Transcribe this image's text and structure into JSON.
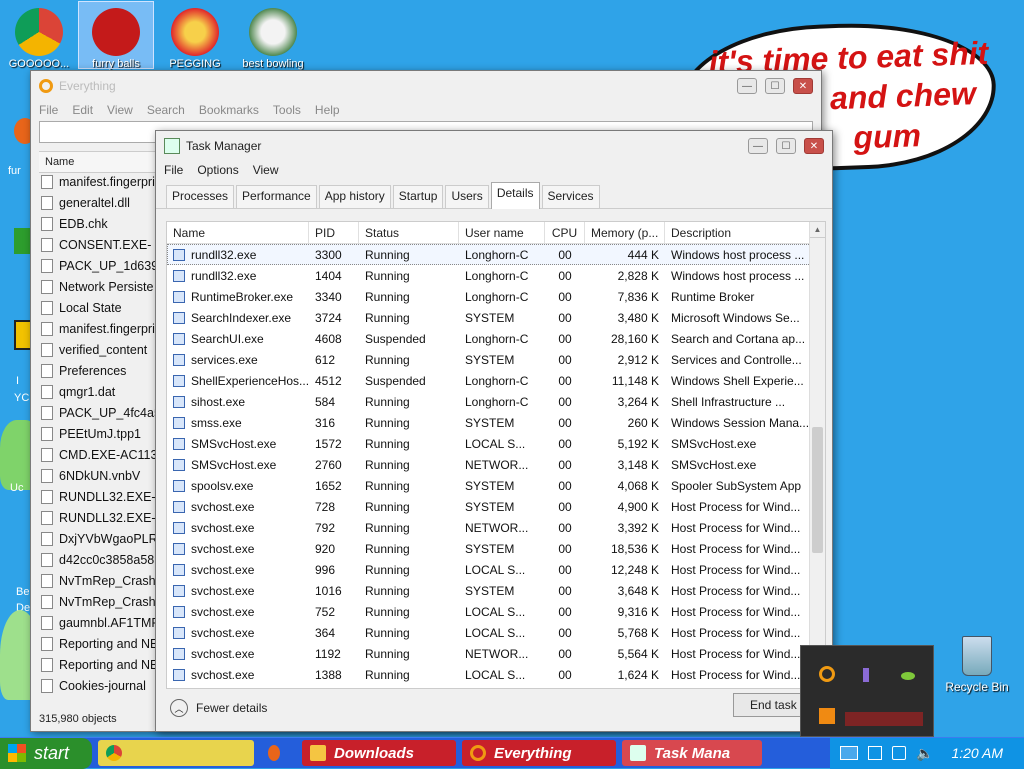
{
  "desktop": {
    "icons": [
      {
        "label": "GOOOOO...",
        "color": "#dd4b39"
      },
      {
        "label": "furry balls",
        "color": "#c41a1a"
      },
      {
        "label": "PEGGING",
        "color": "#e0282b"
      },
      {
        "label": "best bowling",
        "color": "#3a7a3a"
      }
    ],
    "left_labels": [
      "fur",
      "I",
      "YC",
      "Uc",
      "Be",
      "De"
    ],
    "recycle_bin": "Recycle Bin"
  },
  "bubble": {
    "lines": [
      "it's time to eat shit",
      "and chew",
      "gum"
    ]
  },
  "everything": {
    "title": "Everything",
    "menu": [
      "File",
      "Edit",
      "View",
      "Search",
      "Bookmarks",
      "Tools",
      "Help"
    ],
    "search_value": "",
    "column": "Name",
    "files": [
      "manifest.fingerpri",
      "generaltel.dll",
      "EDB.chk",
      "CONSENT.EXE-",
      "PACK_UP_1d639f",
      "Network Persiste",
      "Local State",
      "manifest.fingerpri",
      "verified_content",
      "Preferences",
      "qmgr1.dat",
      "PACK_UP_4fc4a5",
      "PEEtUmJ.tpp1",
      "CMD.EXE-AC113A",
      "6NDkUN.vnbV",
      "RUNDLL32.EXE-",
      "RUNDLL32.EXE-",
      "DxjYVbWgaoPLR",
      "d42cc0c3858a58",
      "NvTmRep_CrashR",
      "NvTmRep_CrashR",
      "gaumnbl.AF1TMP",
      "Reporting and NE",
      "Reporting and NE",
      "Cookies-journal"
    ],
    "status": "315,980 objects"
  },
  "taskmanager": {
    "title": "Task Manager",
    "menu": [
      "File",
      "Options",
      "View"
    ],
    "tabs": [
      "Processes",
      "Performance",
      "App history",
      "Startup",
      "Users",
      "Details",
      "Services"
    ],
    "active_tab": "Details",
    "columns": [
      "Name",
      "PID",
      "Status",
      "User name",
      "CPU",
      "Memory (p...",
      "Description"
    ],
    "rows": [
      [
        "rundll32.exe",
        "3300",
        "Running",
        "Longhorn-C",
        "00",
        "444 K",
        "Windows host process ..."
      ],
      [
        "rundll32.exe",
        "1404",
        "Running",
        "Longhorn-C",
        "00",
        "2,828 K",
        "Windows host process ..."
      ],
      [
        "RuntimeBroker.exe",
        "3340",
        "Running",
        "Longhorn-C",
        "00",
        "7,836 K",
        "Runtime Broker"
      ],
      [
        "SearchIndexer.exe",
        "3724",
        "Running",
        "SYSTEM",
        "00",
        "3,480 K",
        "Microsoft Windows Se..."
      ],
      [
        "SearchUI.exe",
        "4608",
        "Suspended",
        "Longhorn-C",
        "00",
        "28,160 K",
        "Search and Cortana ap..."
      ],
      [
        "services.exe",
        "612",
        "Running",
        "SYSTEM",
        "00",
        "2,912 K",
        "Services and Controlle..."
      ],
      [
        "ShellExperienceHos...",
        "4512",
        "Suspended",
        "Longhorn-C",
        "00",
        "11,148 K",
        "Windows Shell Experie..."
      ],
      [
        "sihost.exe",
        "584",
        "Running",
        "Longhorn-C",
        "00",
        "3,264 K",
        "Shell Infrastructure ..."
      ],
      [
        "smss.exe",
        "316",
        "Running",
        "SYSTEM",
        "00",
        "260 K",
        "Windows Session Mana..."
      ],
      [
        "SMSvcHost.exe",
        "1572",
        "Running",
        "LOCAL S...",
        "00",
        "5,192 K",
        "SMSvcHost.exe"
      ],
      [
        "SMSvcHost.exe",
        "2760",
        "Running",
        "NETWOR...",
        "00",
        "3,148 K",
        "SMSvcHost.exe"
      ],
      [
        "spoolsv.exe",
        "1652",
        "Running",
        "SYSTEM",
        "00",
        "4,068 K",
        "Spooler SubSystem App"
      ],
      [
        "svchost.exe",
        "728",
        "Running",
        "SYSTEM",
        "00",
        "4,900 K",
        "Host Process for Wind..."
      ],
      [
        "svchost.exe",
        "792",
        "Running",
        "NETWOR...",
        "00",
        "3,392 K",
        "Host Process for Wind..."
      ],
      [
        "svchost.exe",
        "920",
        "Running",
        "SYSTEM",
        "00",
        "18,536 K",
        "Host Process for Wind..."
      ],
      [
        "svchost.exe",
        "996",
        "Running",
        "LOCAL S...",
        "00",
        "12,248 K",
        "Host Process for Wind..."
      ],
      [
        "svchost.exe",
        "1016",
        "Running",
        "SYSTEM",
        "00",
        "3,648 K",
        "Host Process for Wind..."
      ],
      [
        "svchost.exe",
        "752",
        "Running",
        "LOCAL S...",
        "00",
        "9,316 K",
        "Host Process for Wind..."
      ],
      [
        "svchost.exe",
        "364",
        "Running",
        "LOCAL S...",
        "00",
        "5,768 K",
        "Host Process for Wind..."
      ],
      [
        "svchost.exe",
        "1192",
        "Running",
        "NETWOR...",
        "00",
        "5,564 K",
        "Host Process for Wind..."
      ],
      [
        "svchost.exe",
        "1388",
        "Running",
        "LOCAL S...",
        "00",
        "1,624 K",
        "Host Process for Wind..."
      ]
    ],
    "fewer_details": "Fewer details",
    "end_task": "End task"
  },
  "taskbar": {
    "start": "start",
    "buttons": [
      {
        "label": "",
        "color": "#e8d44d"
      },
      {
        "label": "",
        "color": "#e05a1f"
      },
      {
        "label": "Downloads",
        "color": "#c8202a"
      },
      {
        "label": "Everything",
        "color": "#c8202a"
      },
      {
        "label": "Task Mana",
        "color": "#c8202a"
      }
    ],
    "time": "1:20 AM"
  },
  "colors": {
    "desktop": "#2fa3e8",
    "taskbar": "#245edb",
    "bubble_text": "#d41313"
  }
}
